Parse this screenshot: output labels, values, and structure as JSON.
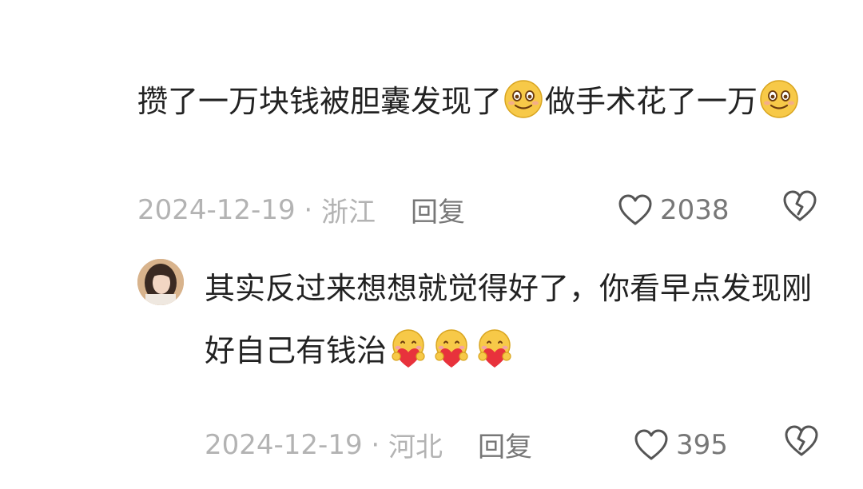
{
  "comments": [
    {
      "text_parts": [
        "攒了一万块钱被胆囊发现了",
        "做手术花了一万"
      ],
      "emojis": [
        "smile-emoji",
        "smile-emoji"
      ],
      "date": "2024-12-19",
      "separator": " · ",
      "location": "浙江",
      "reply_label": "回复",
      "like_count": "2038"
    },
    {
      "text_parts": [
        "其实反过来想想就觉得好了，你看早点发现刚好自己有钱治"
      ],
      "emojis": [
        "heart-hug-emoji",
        "heart-hug-emoji",
        "heart-hug-emoji"
      ],
      "date": "2024-12-19",
      "separator": " · ",
      "location": "河北",
      "reply_label": "回复",
      "like_count": "395"
    }
  ],
  "colors": {
    "text": "#222222",
    "meta": "#b3b3b3",
    "action": "#777777",
    "emoji_face": "#f7c948",
    "heart": "#e8323c"
  }
}
